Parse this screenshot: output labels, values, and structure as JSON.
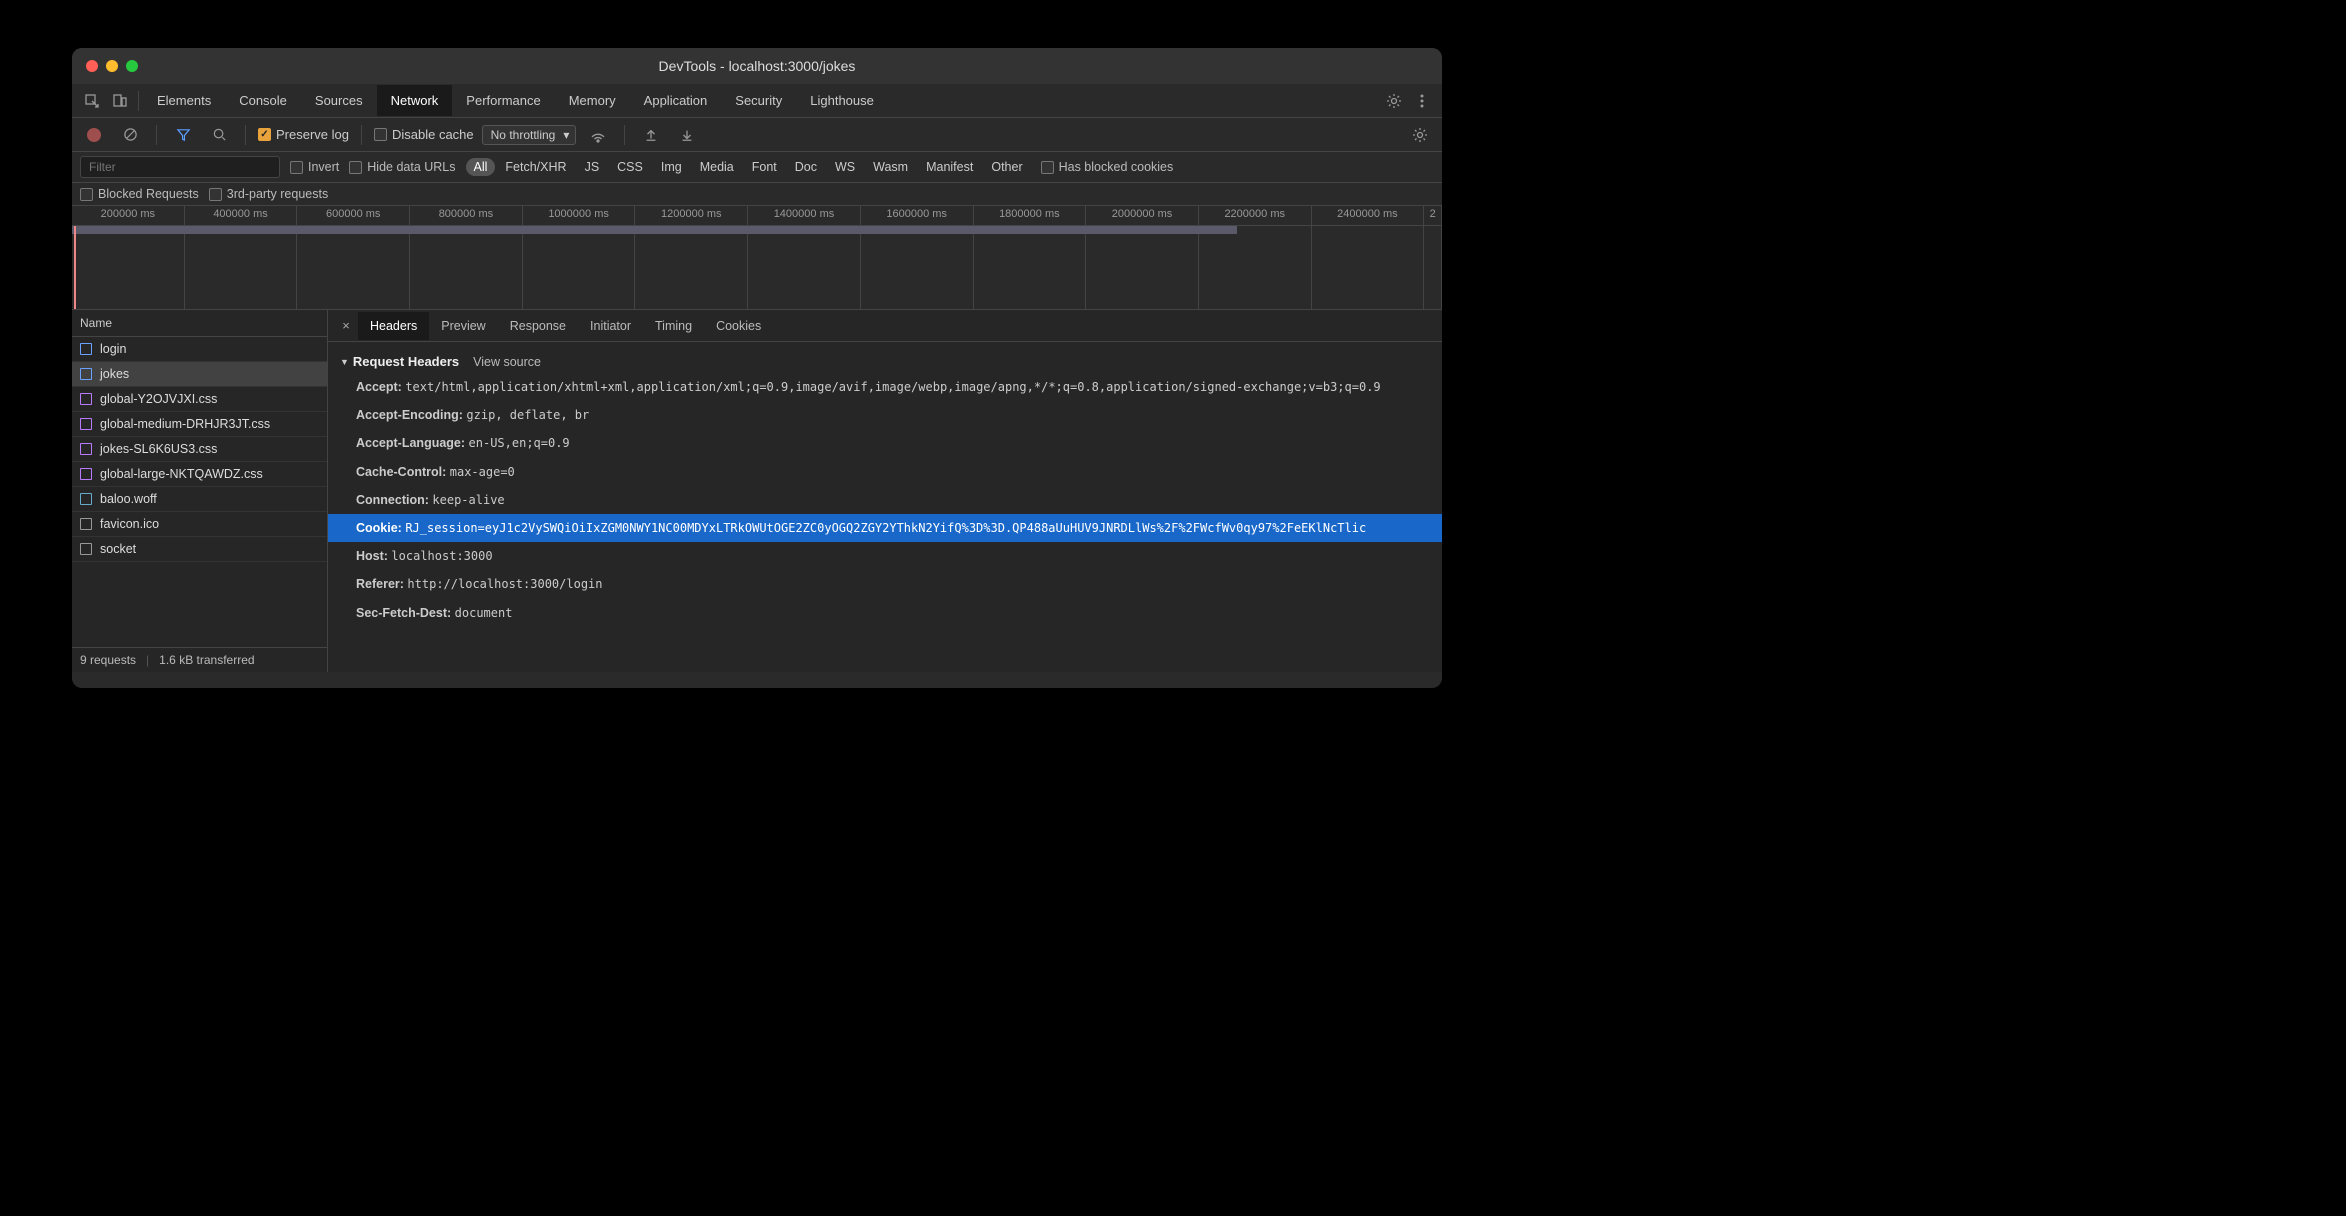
{
  "window": {
    "title": "DevTools - localhost:3000/jokes"
  },
  "main_tabs": [
    "Elements",
    "Console",
    "Sources",
    "Network",
    "Performance",
    "Memory",
    "Application",
    "Security",
    "Lighthouse"
  ],
  "main_tab_active": "Network",
  "toolbar": {
    "preserve_log": "Preserve log",
    "disable_cache": "Disable cache",
    "throttling": "No throttling"
  },
  "filter": {
    "placeholder": "Filter",
    "invert": "Invert",
    "hide_data_urls": "Hide data URLs",
    "types": [
      "All",
      "Fetch/XHR",
      "JS",
      "CSS",
      "Img",
      "Media",
      "Font",
      "Doc",
      "WS",
      "Wasm",
      "Manifest",
      "Other"
    ],
    "type_active": "All",
    "has_blocked_cookies": "Has blocked cookies",
    "blocked_requests": "Blocked Requests",
    "third_party": "3rd-party requests"
  },
  "timeline_ticks": [
    "200000 ms",
    "400000 ms",
    "600000 ms",
    "800000 ms",
    "1000000 ms",
    "1200000 ms",
    "1400000 ms",
    "1600000 ms",
    "1800000 ms",
    "2000000 ms",
    "2200000 ms",
    "2400000 ms"
  ],
  "requests": {
    "col_name": "Name",
    "items": [
      {
        "name": "login",
        "icon": "doc"
      },
      {
        "name": "jokes",
        "icon": "doc",
        "selected": true
      },
      {
        "name": "global-Y2OJVJXI.css",
        "icon": "css"
      },
      {
        "name": "global-medium-DRHJR3JT.css",
        "icon": "css"
      },
      {
        "name": "jokes-SL6K6US3.css",
        "icon": "css"
      },
      {
        "name": "global-large-NKTQAWDZ.css",
        "icon": "css"
      },
      {
        "name": "baloo.woff",
        "icon": "font"
      },
      {
        "name": "favicon.ico",
        "icon": "other"
      },
      {
        "name": "socket",
        "icon": "other"
      }
    ],
    "summary_requests": "9 requests",
    "summary_transferred": "1.6 kB transferred"
  },
  "detail": {
    "tabs": [
      "Headers",
      "Preview",
      "Response",
      "Initiator",
      "Timing",
      "Cookies"
    ],
    "tab_active": "Headers",
    "section_title": "Request Headers",
    "view_source": "View source",
    "headers": [
      {
        "k": "Accept:",
        "v": "text/html,application/xhtml+xml,application/xml;q=0.9,image/avif,image/webp,image/apng,*/*;q=0.8,application/signed-exchange;v=b3;q=0.9"
      },
      {
        "k": "Accept-Encoding:",
        "v": "gzip, deflate, br"
      },
      {
        "k": "Accept-Language:",
        "v": "en-US,en;q=0.9"
      },
      {
        "k": "Cache-Control:",
        "v": "max-age=0"
      },
      {
        "k": "Connection:",
        "v": "keep-alive"
      },
      {
        "k": "Cookie:",
        "v": "RJ_session=eyJ1c2VySWQiOiIxZGM0NWY1NC00MDYxLTRkOWUtOGE2ZC0yOGQ2ZGY2YThkN2YifQ%3D%3D.QP488aUuHUV9JNRDLlWs%2F%2FWcfWv0qy97%2FeEKlNcTlic",
        "hl": true
      },
      {
        "k": "Host:",
        "v": "localhost:3000"
      },
      {
        "k": "Referer:",
        "v": "http://localhost:3000/login"
      },
      {
        "k": "Sec-Fetch-Dest:",
        "v": "document"
      }
    ]
  }
}
